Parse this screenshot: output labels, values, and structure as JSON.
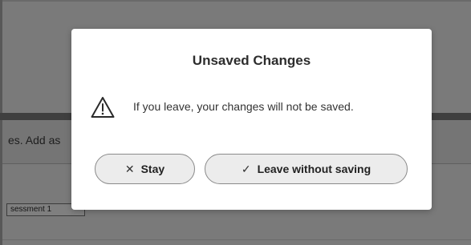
{
  "background": {
    "instruction_text": "es. Add as",
    "field_value": "sessment 1"
  },
  "dialog": {
    "title": "Unsaved Changes",
    "icon": "warning-icon",
    "message": "If you leave, your changes will not be saved.",
    "buttons": {
      "stay": {
        "icon": "close-icon",
        "glyph": "✕",
        "label": "Stay"
      },
      "leave": {
        "icon": "check-icon",
        "glyph": "✓",
        "label": "Leave without saving"
      }
    }
  },
  "colors": {
    "backdrop": "#7a7a7a",
    "dialog_background": "#ffffff",
    "button_background": "#ececec",
    "title_text": "#2d2d2d"
  }
}
